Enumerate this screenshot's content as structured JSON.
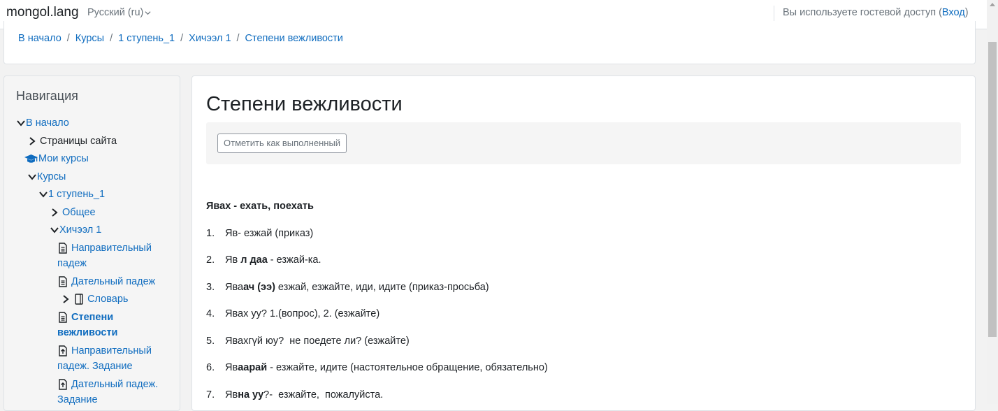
{
  "navbar": {
    "brand": "mongol.lang",
    "language": "Русский (ru)",
    "guest_text": "Вы используете гостевой доступ (",
    "login_link": "Вход",
    "guest_close": ")"
  },
  "breadcrumb": [
    "В начало",
    "Курсы",
    "1 ступень_1",
    "Хичээл 1",
    "Степени вежливости"
  ],
  "breadcrumb_separator": "/",
  "navigation": {
    "title": "Навигация",
    "items": [
      {
        "label": "В начало",
        "icon": "chevron-down-icon"
      },
      {
        "label": "Страницы сайта",
        "icon": "chevron-right-icon"
      },
      {
        "label": "Мои курсы",
        "icon": "graduation-cap-icon"
      },
      {
        "label": "Курсы",
        "icon": "chevron-down-icon"
      },
      {
        "label": "1 ступень_1",
        "icon": "chevron-down-icon"
      },
      {
        "label": "Общее",
        "icon": "chevron-right-icon"
      },
      {
        "label": "Хичээл 1",
        "icon": "chevron-down-icon"
      },
      {
        "label_1": "Направительный",
        "label_2": "падеж",
        "icon": "page-icon"
      },
      {
        "label": "Дательный падеж",
        "icon": "page-icon"
      },
      {
        "label": "Словарь",
        "icon": "glossary-icon"
      },
      {
        "label_1": "Степени",
        "label_2": "вежливости",
        "icon": "page-icon",
        "current": true
      },
      {
        "label_1": "Направительный",
        "label_2": "падеж. Задание",
        "icon": "assignment-icon"
      },
      {
        "label_1": "Дательный падеж.",
        "label_2": "Задание",
        "icon": "assignment-icon"
      }
    ]
  },
  "main": {
    "title": "Степени вежливости",
    "mark_button": "Отметить как выполненный",
    "heading": "Явах - ехать, поехать",
    "lines": [
      {
        "num": "1.",
        "parts": [
          {
            "t": "Яв- езжай (приказ)",
            "b": false
          }
        ]
      },
      {
        "num": "2.",
        "parts": [
          {
            "t": "Яв ",
            "b": false
          },
          {
            "t": "л даа",
            "b": true
          },
          {
            "t": " - езжай-ка.",
            "b": false
          }
        ]
      },
      {
        "num": "3.",
        "parts": [
          {
            "t": "Ява",
            "b": false
          },
          {
            "t": "ач (ээ)",
            "b": true
          },
          {
            "t": " езжай, езжайте, иди, идите (приказ-просьба)",
            "b": false
          }
        ]
      },
      {
        "num": "4.",
        "parts": [
          {
            "t": "Явах уу? 1.(вопрос), 2. (езжайте)",
            "b": false
          }
        ]
      },
      {
        "num": "5.",
        "parts": [
          {
            "t": "Явахгүй юу?  не поедете ли? (езжайте)",
            "b": false
          }
        ]
      },
      {
        "num": "6.",
        "parts": [
          {
            "t": "Яв",
            "b": false
          },
          {
            "t": "аарай",
            "b": true
          },
          {
            "t": " - езжайте, идите (настоятельное обращение, обязательно)",
            "b": false
          }
        ]
      },
      {
        "num": "7.",
        "parts": [
          {
            "t": "Яв",
            "b": false
          },
          {
            "t": "на уу",
            "b": true
          },
          {
            "t": "?-  езжайте,  пожалуйста.",
            "b": false
          }
        ]
      }
    ]
  }
}
